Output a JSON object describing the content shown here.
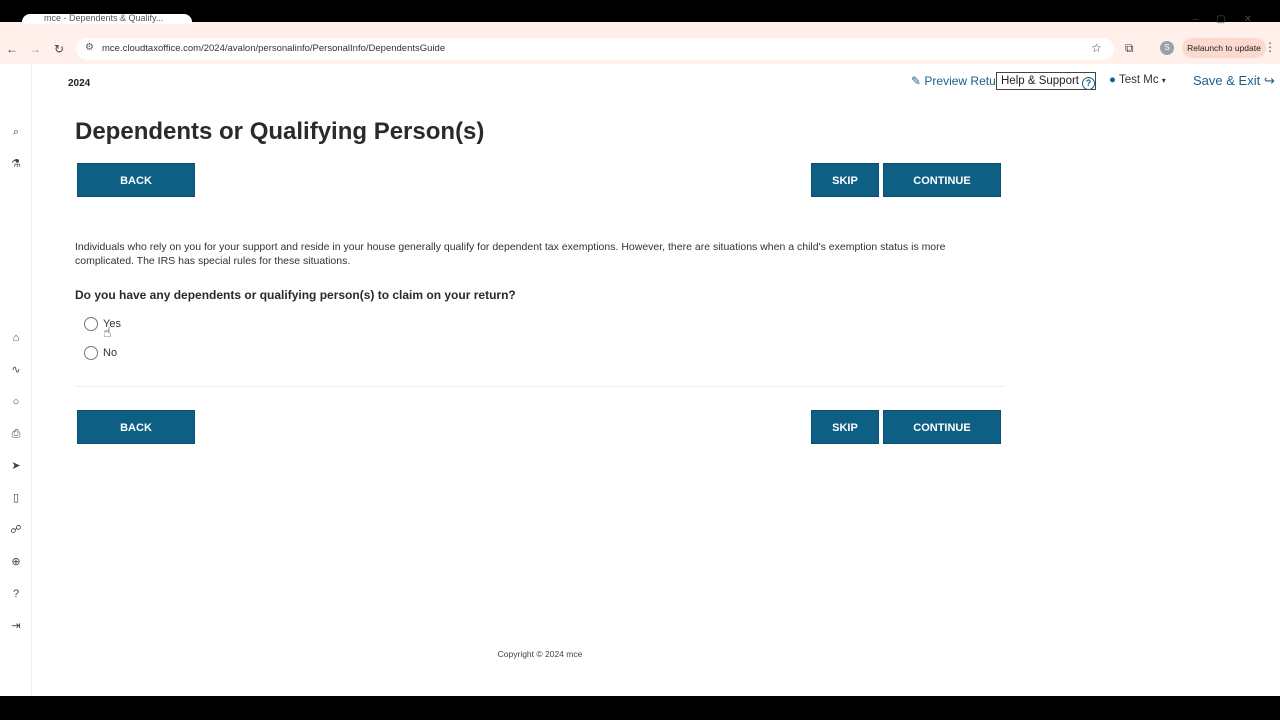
{
  "browser": {
    "tab_title": "mce - Dependents & Qualify...",
    "url": "mce.cloudtaxoffice.com/2024/avalon/personalinfo/PersonalInfo/DependentsGuide",
    "profile_initial": "S",
    "relaunch_label": "Relaunch to update"
  },
  "header": {
    "year": "2024",
    "preview_return": "Preview Return",
    "help_support": "Help & Support",
    "user_name": "Test Mc",
    "save_exit": "Save & Exit"
  },
  "main": {
    "title": "Dependents or Qualifying Person(s)",
    "back_label": "BACK",
    "skip_label": "SKIP",
    "continue_label": "CONTINUE",
    "description": "Individuals who rely on you for your support and reside in your house generally qualify for dependent tax exemptions. However, there are situations when a child's exemption status is more complicated. The IRS has special rules for these situations.",
    "question": "Do you have any dependents or qualifying person(s) to claim on your return?",
    "options": [
      "Yes",
      "No"
    ]
  },
  "footer": {
    "copyright": "Copyright © 2024 mce"
  },
  "colors": {
    "primary_button": "#0e5f84",
    "link": "#1a5f87"
  },
  "icons": [
    "search-icon",
    "flask-icon",
    "bank-icon",
    "stethoscope-icon",
    "lightbulb-icon",
    "printer-icon",
    "paper-plane-icon",
    "document-icon",
    "sitemap-icon",
    "plus-circle-icon",
    "question-circle-icon",
    "sign-out-icon"
  ]
}
